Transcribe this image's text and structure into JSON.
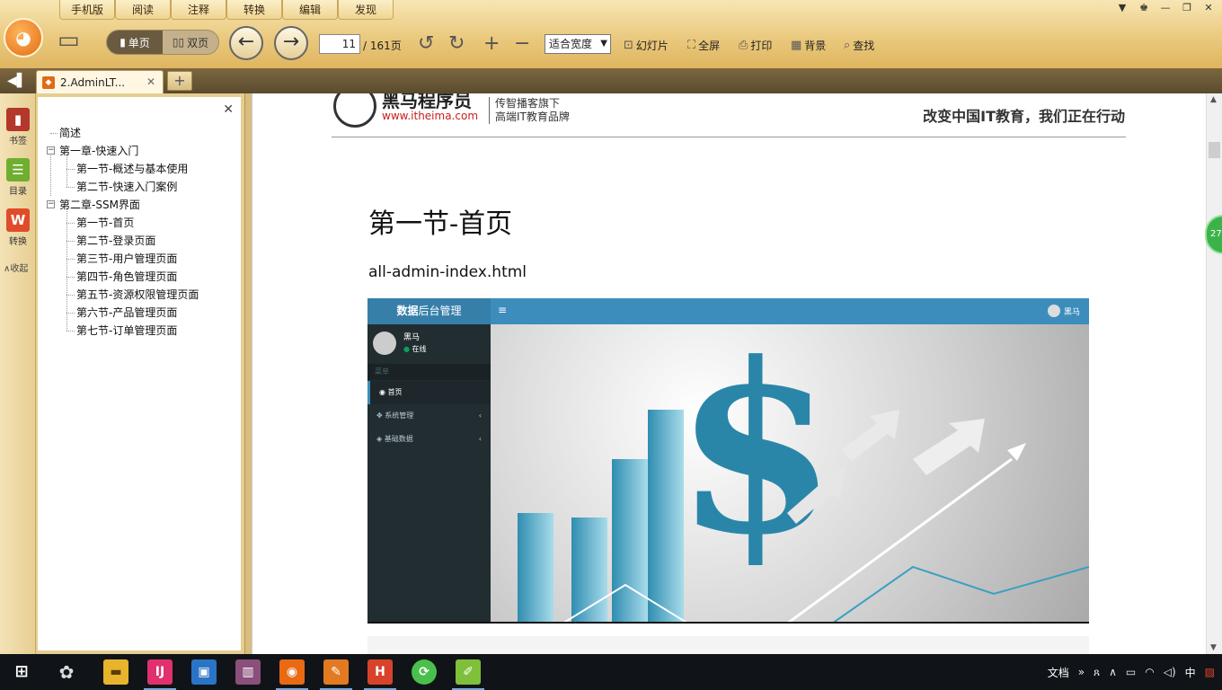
{
  "menu_tabs": [
    "手机版",
    "阅读",
    "注释",
    "转换",
    "编辑",
    "发现"
  ],
  "toolbar": {
    "single_page": "单页",
    "double_page": "双页",
    "current_page": "11",
    "total_pages": "/ 161页",
    "zoom": "适合宽度",
    "slideshow": "幻灯片",
    "fullscreen": "全屏",
    "print": "打印",
    "background": "背景",
    "find": "查找"
  },
  "doc_tab": {
    "title": "2.AdminLT..."
  },
  "rail": {
    "bookmark": "书签",
    "toc": "目录",
    "convert": "转换",
    "collapse": "收起"
  },
  "outline": [
    {
      "label": "简述",
      "level": 0,
      "toggle": ""
    },
    {
      "label": "第一章-快速入门",
      "level": 0,
      "toggle": "−"
    },
    {
      "label": "第一节-概述与基本使用",
      "level": 1,
      "toggle": ""
    },
    {
      "label": "第二节-快速入门案例",
      "level": 1,
      "toggle": ""
    },
    {
      "label": "第二章-SSM界面",
      "level": 0,
      "toggle": "−"
    },
    {
      "label": "第一节-首页",
      "level": 1,
      "toggle": ""
    },
    {
      "label": "第二节-登录页面",
      "level": 1,
      "toggle": ""
    },
    {
      "label": "第三节-用户管理页面",
      "level": 1,
      "toggle": ""
    },
    {
      "label": "第四节-角色管理页面",
      "level": 1,
      "toggle": ""
    },
    {
      "label": "第五节-资源权限管理页面",
      "level": 1,
      "toggle": ""
    },
    {
      "label": "第六节-产品管理页面",
      "level": 1,
      "toggle": ""
    },
    {
      "label": "第七节-订单管理页面",
      "level": 1,
      "toggle": ""
    }
  ],
  "document": {
    "brand": "黑马程序员",
    "brand_url": "www.itheima.com",
    "brand_sub1": "传智播客旗下",
    "brand_sub2": "高端IT教育品牌",
    "slogan": "改变中国IT教育，我们正在行动",
    "section_title": "第一节-首页",
    "filename": "all-admin-index.html"
  },
  "screenshot": {
    "brand_bold": "数据",
    "brand_rest": "后台管理",
    "burger": "≡",
    "top_user": "黑马",
    "user_name": "黑马",
    "user_status": "在线",
    "menu_header": "菜单",
    "menu_items": [
      {
        "label": "首页",
        "icon": "◉",
        "chevron": ""
      },
      {
        "label": "系统管理",
        "icon": "✥",
        "chevron": "‹"
      },
      {
        "label": "基础数据",
        "icon": "◈",
        "chevron": "‹"
      }
    ]
  },
  "float_badge": "27",
  "taskbar": {
    "doc_label": "文档",
    "ime": "中"
  },
  "colors": {
    "reader_theme": "#e9c77a",
    "admin_header": "#3c8dbc",
    "admin_sidebar": "#222d32",
    "accent_green": "#3cb34a"
  }
}
